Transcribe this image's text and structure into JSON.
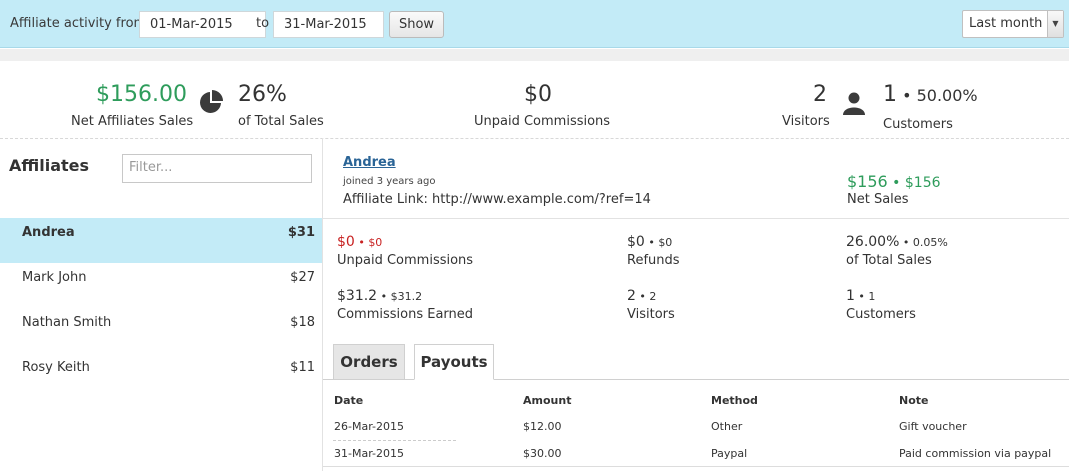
{
  "filter_bar": {
    "label": "Affiliate activity from",
    "from_date": "01-Mar-2015",
    "to_label": "to",
    "to_date": "31-Mar-2015",
    "show_label": "Show",
    "period_selected": "Last month"
  },
  "summary": {
    "net_sales": "$156.00",
    "net_sales_label": "Net Affiliates Sales",
    "pct_total": "26%",
    "pct_total_label": "of Total Sales",
    "unpaid": "$0",
    "unpaid_label": "Unpaid Commissions",
    "visitors": "2",
    "visitors_label": "Visitors",
    "customers": "1",
    "customers_pct": "50.00%",
    "customers_label": "Customers"
  },
  "affiliates": {
    "title": "Affiliates",
    "filter_placeholder": "Filter...",
    "items": [
      {
        "name": "Andrea",
        "amount": "$31"
      },
      {
        "name": "Mark John",
        "amount": "$27"
      },
      {
        "name": "Nathan Smith",
        "amount": "$18"
      },
      {
        "name": "Rosy Keith",
        "amount": "$11"
      }
    ]
  },
  "detail": {
    "name": "Andrea",
    "joined": "joined 3 years ago",
    "link": "Affiliate Link: http://www.example.com/?ref=14",
    "net_sales": "$156",
    "net_sales_sub": "$156",
    "net_sales_label": "Net Sales",
    "stats": {
      "unpaid": "$0",
      "unpaid_sub": "$0",
      "unpaid_label": "Unpaid Commissions",
      "refunds": "$0",
      "refunds_sub": "$0",
      "refunds_label": "Refunds",
      "pct": "26.00%",
      "pct_sub": "0.05%",
      "pct_label": "of Total Sales",
      "earned": "$31.2",
      "earned_sub": "$31.2",
      "earned_label": "Commissions Earned",
      "visitors": "2",
      "visitors_sub": "2",
      "visitors_label": "Visitors",
      "customers": "1",
      "customers_sub": "1",
      "customers_label": "Customers"
    },
    "tabs": [
      {
        "label": "Orders"
      },
      {
        "label": "Payouts"
      }
    ],
    "payouts": {
      "columns": [
        "Date",
        "Amount",
        "Method",
        "Note"
      ],
      "rows": [
        [
          "26-Mar-2015",
          "$12.00",
          "Other",
          "Gift voucher"
        ],
        [
          "31-Mar-2015",
          "$30.00",
          "Paypal",
          "Paid commission via paypal"
        ]
      ]
    }
  },
  "colors": {
    "accent_bg": "#c3ebf7",
    "green": "#2e9c5b",
    "red": "#c82222",
    "link": "#2a6496"
  }
}
